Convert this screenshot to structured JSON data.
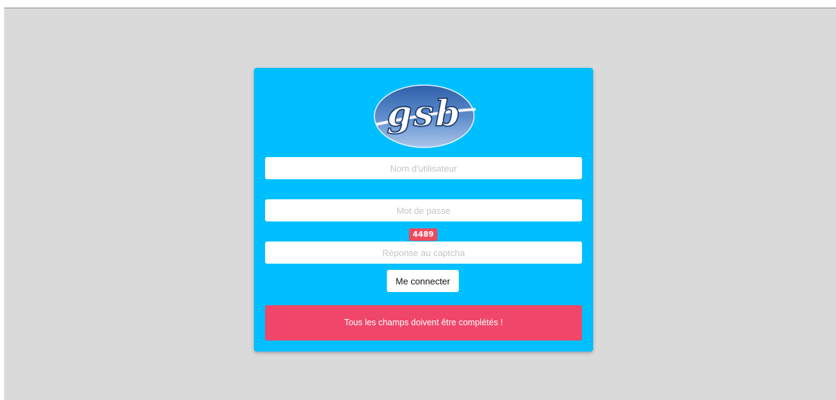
{
  "colors": {
    "page_background": "#dadada",
    "card_background": "#00bfff",
    "captcha_badge": "#ef4a5e",
    "error_alert": "#f0466a"
  },
  "logo": {
    "text": "gsb"
  },
  "login_form": {
    "username_placeholder": "Nom d'utilisateur",
    "password_placeholder": "Mot de passe",
    "captcha_code": "4489",
    "captcha_placeholder": "Réponse au captcha",
    "submit_label": "Me connecter"
  },
  "error_message": "Tous les champs doivent être complétés !"
}
